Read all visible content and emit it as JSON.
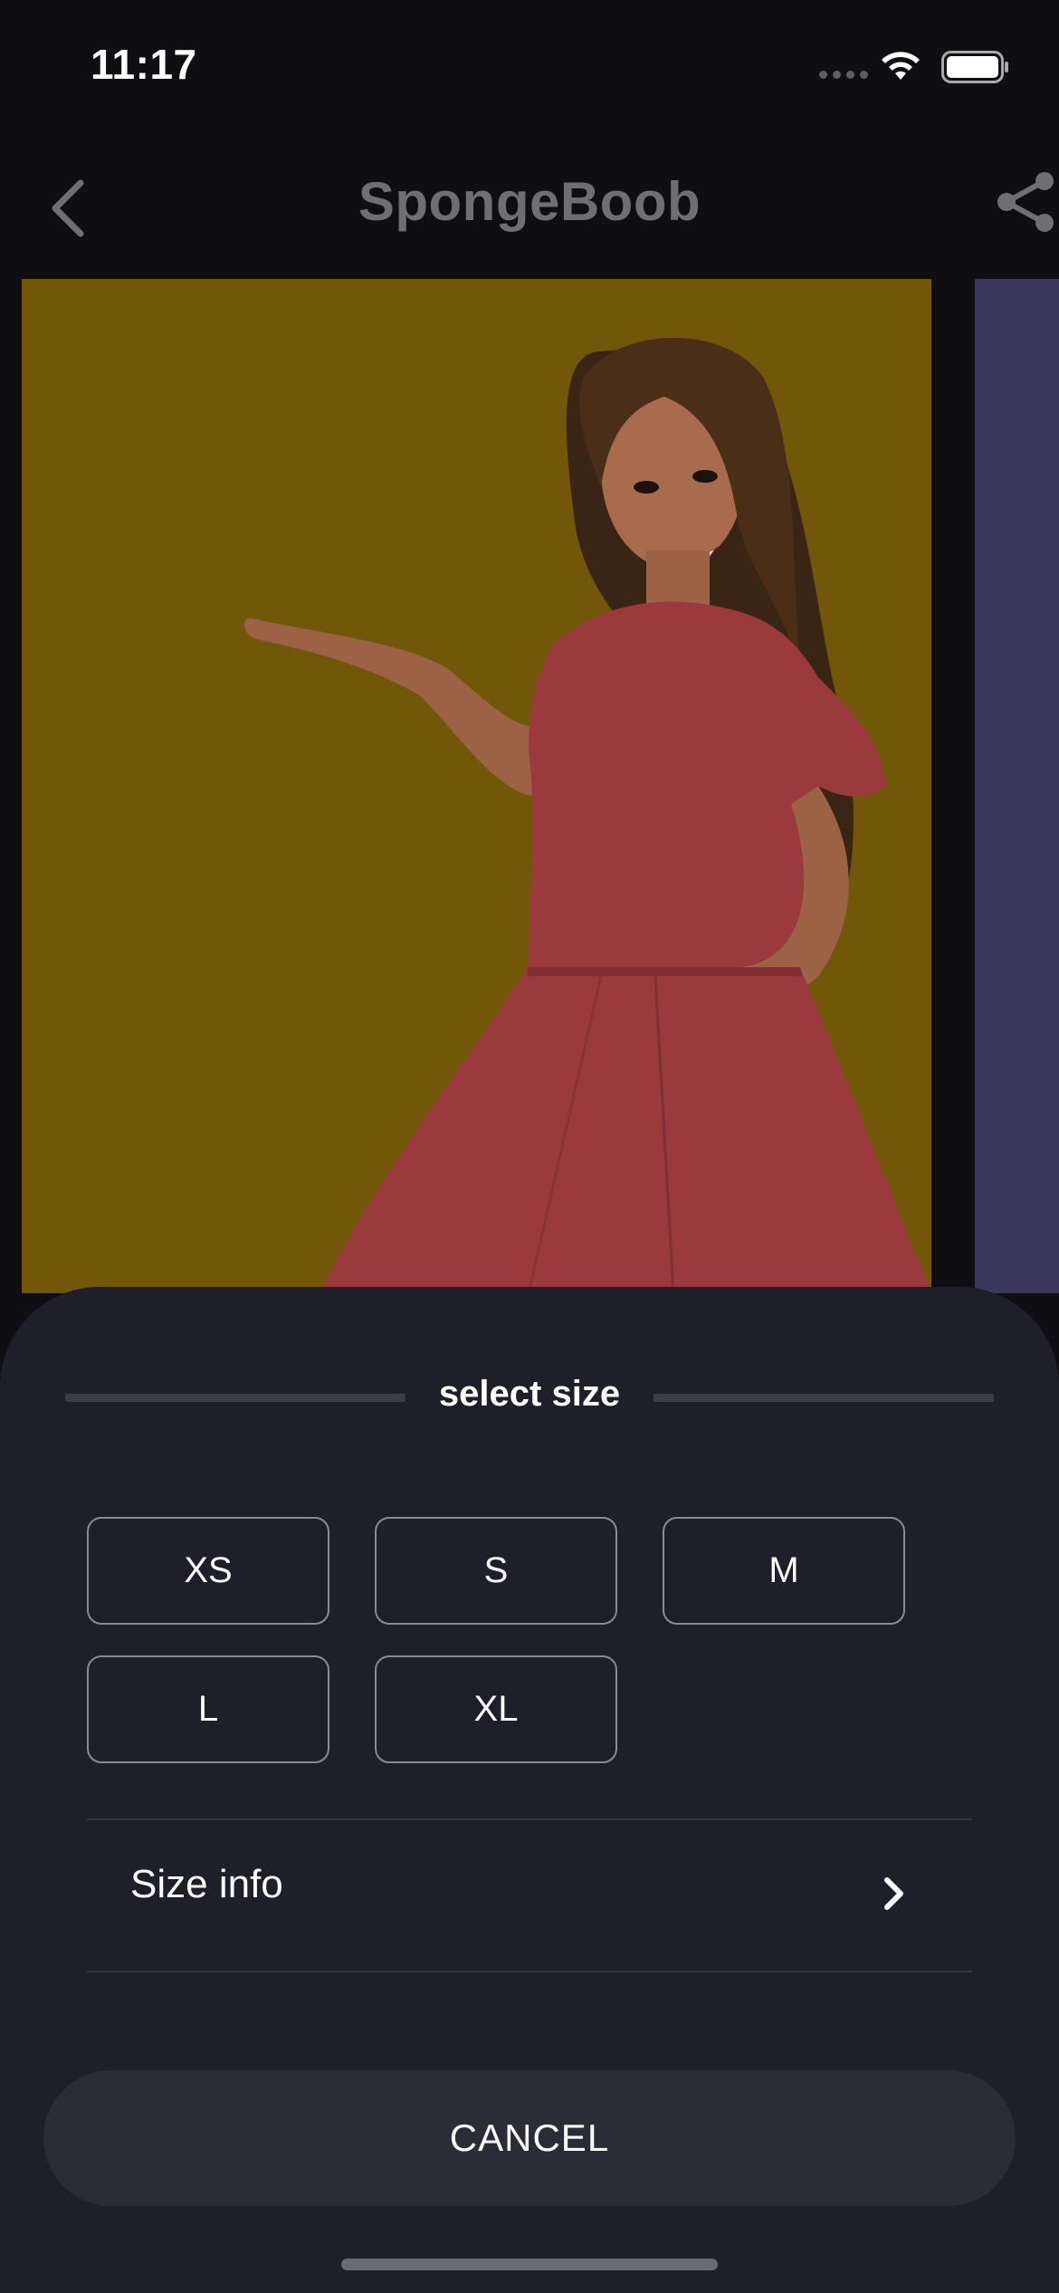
{
  "status": {
    "time": "11:17"
  },
  "nav": {
    "title": "SpongeBoob"
  },
  "sheet": {
    "title": "select size",
    "sizes": [
      "XS",
      "S",
      "M",
      "L",
      "XL"
    ],
    "size_info_label": "Size info",
    "cancel_label": "CANCEL"
  },
  "colors": {
    "background": "#0e0e13",
    "sheet": "#1f1f29",
    "image_backdrop": "#72570b",
    "dress": "#9a3a3d",
    "cancel_button": "#2b2c37"
  },
  "icons": [
    "back-icon",
    "share-icon",
    "wifi-icon",
    "battery-icon",
    "chevron-right-icon"
  ]
}
